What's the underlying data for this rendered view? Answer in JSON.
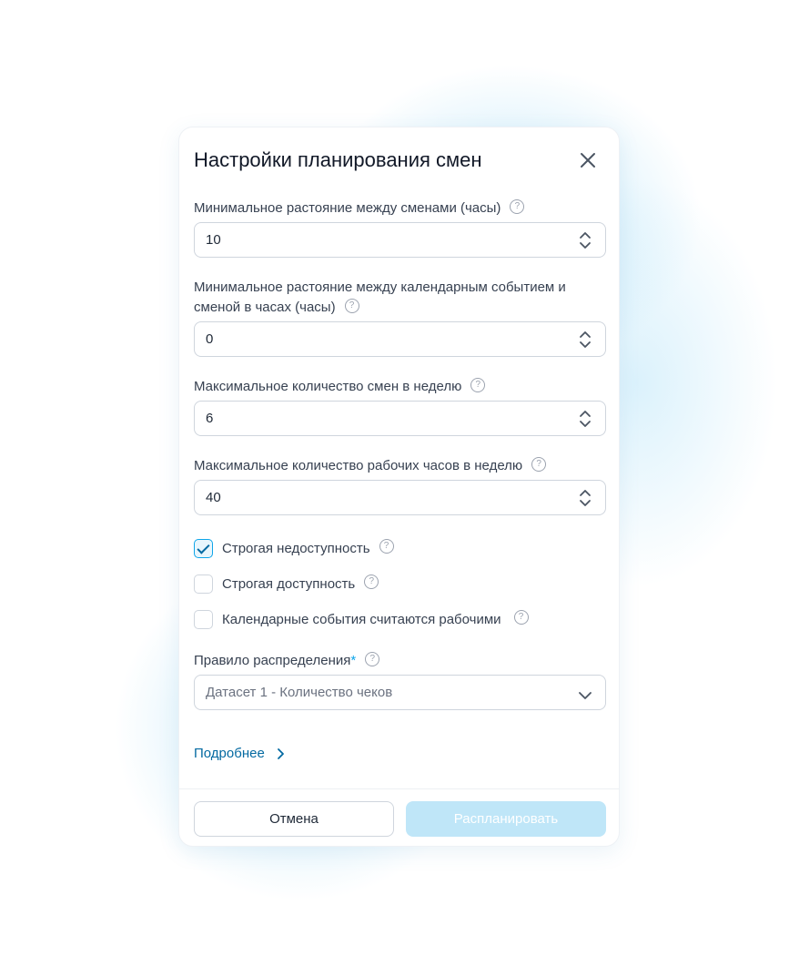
{
  "dialog": {
    "title": "Настройки планирования смен",
    "close_icon": "close-icon"
  },
  "fields": {
    "min_between_shifts": {
      "label": "Минимальное растояние между сменами (часы)",
      "value": "10"
    },
    "min_event_shift": {
      "label_line1": "Минимальное растояние между календарным событием и",
      "label_line2": "сменой в часах (часы)",
      "value": "0"
    },
    "max_shifts_week": {
      "label": "Максимальное количество смен в неделю",
      "value": "6"
    },
    "max_hours_week": {
      "label": "Максимальное количество рабочих часов в неделю",
      "value": "40"
    }
  },
  "checkboxes": {
    "strict_unavailability": {
      "label": "Строгая недоступность",
      "checked": true
    },
    "strict_availability": {
      "label": "Строгая доступность",
      "checked": false
    },
    "events_are_work": {
      "label": "Календарные события считаются рабочими",
      "checked": false
    }
  },
  "distribution": {
    "label": "Правило распределения",
    "required_mark": "*",
    "placeholder": "Датасет 1 - Количество чеков"
  },
  "more_link": "Подробнее",
  "help_glyph": "?",
  "buttons": {
    "cancel": "Отмена",
    "submit": "Распланировать"
  },
  "colors": {
    "accent": "#0ea5e9",
    "link": "#0369a1",
    "submit_disabled_bg": "#bfe6f8"
  }
}
